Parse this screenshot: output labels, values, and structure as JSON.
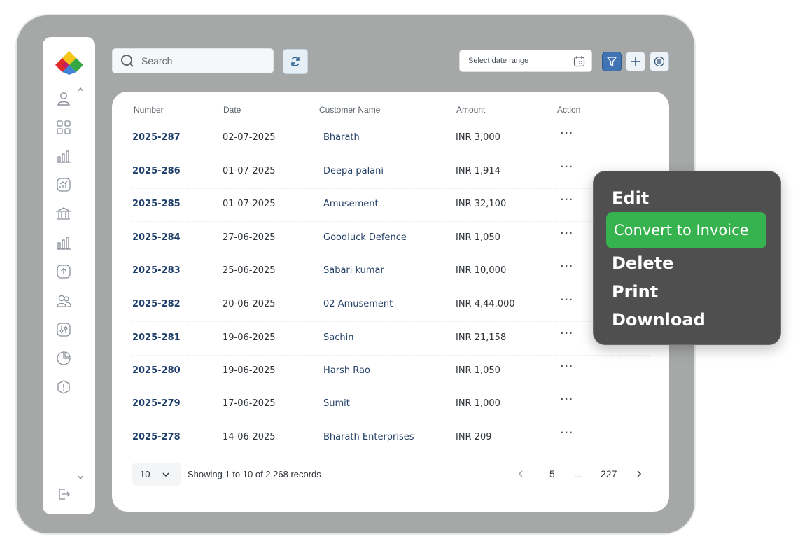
{
  "search": {
    "placeholder": "Search"
  },
  "date_filter": {
    "placeholder": "Select date range"
  },
  "table": {
    "headers": [
      "Number",
      "Date",
      "Customer Name",
      "Amount",
      "Action"
    ],
    "rows": [
      {
        "number": "2025-287",
        "date": "02-07-2025",
        "customer": "Bharath",
        "amount": "INR 3,000"
      },
      {
        "number": "2025-286",
        "date": "01-07-2025",
        "customer": "Deepa palani",
        "amount": "INR 1,914"
      },
      {
        "number": "2025-285",
        "date": "01-07-2025",
        "customer": "Amusement",
        "amount": "INR 32,100"
      },
      {
        "number": "2025-284",
        "date": "27-06-2025",
        "customer": "Goodluck Defence",
        "amount": "INR 1,050"
      },
      {
        "number": "2025-283",
        "date": "25-06-2025",
        "customer": "Sabari kumar",
        "amount": "INR 10,000"
      },
      {
        "number": "2025-282",
        "date": "20-06-2025",
        "customer": "02 Amusement",
        "amount": "INR 4,44,000"
      },
      {
        "number": "2025-281",
        "date": "19-06-2025",
        "customer": "Sachin",
        "amount": "INR 21,158"
      },
      {
        "number": "2025-280",
        "date": "19-06-2025",
        "customer": "Harsh Rao",
        "amount": "INR 1,050"
      },
      {
        "number": "2025-279",
        "date": "17-06-2025",
        "customer": "Sumit",
        "amount": "INR 1,000"
      },
      {
        "number": "2025-278",
        "date": "14-06-2025",
        "customer": "Bharath Enterprises",
        "amount": "INR 209"
      }
    ],
    "action_label": "···"
  },
  "pagination": {
    "page_size": "10",
    "info": "Showing 1 to 10 of 2,268 records",
    "current_page": "5",
    "ellipsis": "...",
    "last_page": "227"
  },
  "context_menu": {
    "items": [
      "Edit",
      "Convert to Invoice",
      "Delete",
      "Print",
      "Download"
    ],
    "active_index": 1
  },
  "colors": {
    "frame": "#a6a8a7",
    "accent_blue": "#3f73b4",
    "menu_bg": "#4f4f4f",
    "menu_active": "#36b24f",
    "link_text": "#1f3f6b"
  },
  "sidebar_icons": [
    "user-icon",
    "grid-icon",
    "bar-chart-icon",
    "trend-chart-icon",
    "bank-icon",
    "bar-chart-alt-icon",
    "upload-icon",
    "users-icon",
    "settings-sliders-icon",
    "pie-chart-icon",
    "alert-icon",
    "logout-icon"
  ]
}
